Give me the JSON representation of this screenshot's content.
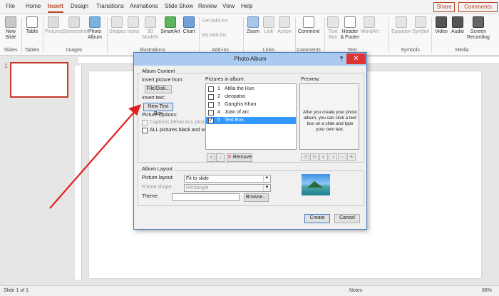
{
  "tabs": [
    "File",
    "Home",
    "Insert",
    "Design",
    "Transitions",
    "Animations",
    "Slide Show",
    "Review",
    "View",
    "Help"
  ],
  "active_tab": "Insert",
  "header_buttons": {
    "share": "Share",
    "comments": "Comments"
  },
  "ribbon": {
    "slides": {
      "new_slide": "New Slide",
      "group": "Slides"
    },
    "tables": {
      "table": "Table",
      "group": "Tables"
    },
    "images": {
      "pictures": "Pictures",
      "screenshot": "Screenshot",
      "photo_album": "Photo Album",
      "group": "Images"
    },
    "illustrations": {
      "shapes": "Shapes",
      "icons": "Icons",
      "models": "3D Models",
      "smartart": "SmartArt",
      "chart": "Chart",
      "group": "Illustrations"
    },
    "addins": {
      "get": "Get Add-ins",
      "my": "My Add-ins",
      "group": "Add-ins"
    },
    "links": {
      "zoom": "Zoom",
      "link": "Link",
      "action": "Action",
      "group": "Links"
    },
    "comments": {
      "comment": "Comment",
      "group": "Comments"
    },
    "text": {
      "textbox": "Text Box",
      "header_footer": "Header & Footer",
      "wordart": "WordArt",
      "group": "Text"
    },
    "symbols": {
      "equation": "Equation",
      "symbol": "Symbol",
      "group": "Symbols"
    },
    "media": {
      "video": "Video",
      "audio": "Audio",
      "screen_recording": "Screen Recording",
      "group": "Media"
    }
  },
  "thumbnail": {
    "number": "1"
  },
  "status": {
    "slide": "Slide 1 of 1",
    "notes": "Notes",
    "zoom": "68%"
  },
  "dialog": {
    "title": "Photo Album",
    "help": "?",
    "close": "✕",
    "album_content": "Album Content",
    "insert_picture_from": "Insert picture from:",
    "file_disk": "File/Disk...",
    "insert_text": "Insert text:",
    "new_text_box": "New Text Box",
    "picture_options": "Picture Options:",
    "captions_below": "Captions below ALL pictures",
    "all_black_white": "ALL pictures black and white",
    "pictures_in_album": "Pictures in album:",
    "pictures": [
      {
        "num": "1",
        "name": "Atilla the Hun",
        "checked": false
      },
      {
        "num": "2",
        "name": "cleopatra",
        "checked": false
      },
      {
        "num": "3",
        "name": "Ganghis Khan",
        "checked": false
      },
      {
        "num": "4",
        "name": "Joan of arc",
        "checked": false
      },
      {
        "num": "5",
        "name": "Text Box",
        "checked": true
      }
    ],
    "remove": "Remove",
    "preview": "Preview:",
    "preview_text": "After you create your photo album, you can click a text box on a slide and type your own text.",
    "album_layout": "Album Layout",
    "picture_layout": "Picture layout:",
    "picture_layout_value": "Fit to slide",
    "frame_shape": "Frame shape:",
    "frame_shape_value": "Rectangle",
    "theme": "Theme:",
    "browse": "Browse...",
    "create": "Create",
    "cancel": "Cancel"
  },
  "colors": {
    "accent": "#b7472a",
    "dialog_title": "#aacaf0",
    "selection": "#3399ff",
    "arrow": "#e02020"
  }
}
